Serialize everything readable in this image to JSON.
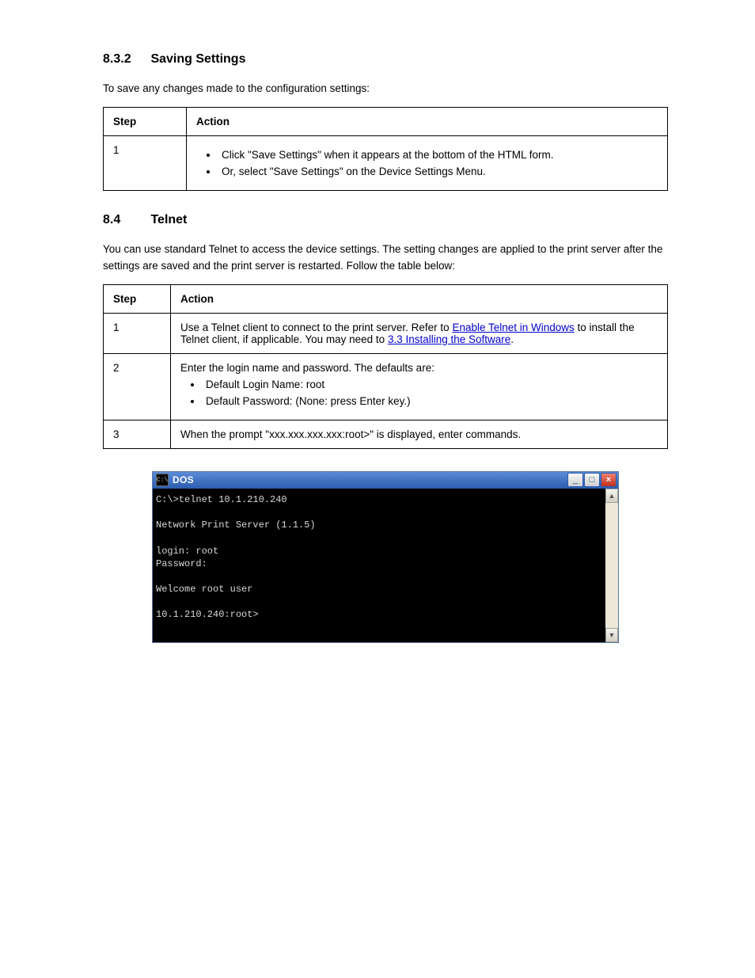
{
  "section1": {
    "num": "8.3.2",
    "title": "Saving Settings",
    "intro": "To save any changes made to the configuration settings:",
    "table_h1": "Step",
    "table_h2": "Action",
    "row1_step": "1",
    "row1_b1": "Click \"Save Settings\" when it appears at the bottom of the HTML form.",
    "row1_b2": "Or, select \"Save Settings\" on the Device Settings Menu."
  },
  "section2": {
    "num": "8.4",
    "title": "Telnet",
    "intro": "You can use standard Telnet to access the device settings. The setting changes are applied to the print server after the settings are saved and the print server is restarted. Follow the table below:",
    "table_h1": "Step",
    "table_h2": "Action",
    "r1_step": "1",
    "r1_pre": "Use a Telnet client to connect to the print server. Refer to ",
    "r1_link1_text": "3.3 Installing the Software",
    "r1_mid": " to install the Telnet client, if applicable. You may need to ",
    "r1_link2_text": "Enable Telnet in Windows",
    "r1_post": ".",
    "r2_step": "2",
    "r2_line1": "Enter the login name and password. The defaults are:",
    "r2_b1_label": "Default Login Name:",
    "r2_b1_val": "root",
    "r2_b2_label": "Default Password:",
    "r2_b2_val": "(None: press Enter key.)",
    "r3_step": "3",
    "r3_text": "When the prompt \"xxx.xxx.xxx.xxx:root>\" is displayed, enter commands."
  },
  "dos": {
    "title": "DOS",
    "icon_label": "C:\\",
    "up": "▲",
    "down": "▼",
    "minimize": "_",
    "maximize": "□",
    "close": "×",
    "lines": {
      "l1": "C:\\>telnet 10.1.210.240",
      "l2": "",
      "l3": "Network Print Server (1.1.5)",
      "l4": "",
      "l5": "login: root",
      "l6": "Password:",
      "l7": "",
      "l8": "Welcome root user",
      "l9": "",
      "l10": "10.1.210.240:root>"
    }
  }
}
